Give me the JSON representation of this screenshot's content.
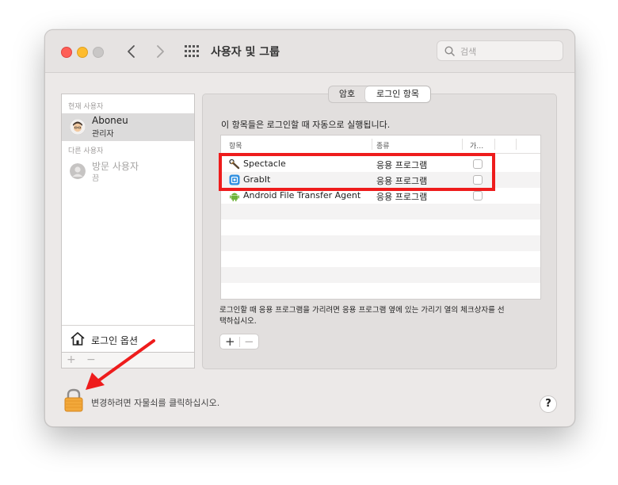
{
  "window": {
    "title": "사용자 및 그룹",
    "search_placeholder": "검색"
  },
  "sidebar": {
    "current_header": "현재 사용자",
    "other_header": "다른 사용자",
    "users": [
      {
        "name": "Aboneu",
        "role": "관리자",
        "selected": true
      },
      {
        "name": "방문 사용자",
        "role": "끔",
        "selected": false
      }
    ],
    "login_options_label": "로그인 옵션",
    "add": "+",
    "remove": "−"
  },
  "tabs": {
    "items": [
      "암호",
      "로그인 항목"
    ],
    "selected": "로그인 항목"
  },
  "login_items": {
    "description": "이 항목들은 로그인할 때 자동으로 실행됩니다.",
    "columns": [
      "항목",
      "종류",
      "가…"
    ],
    "rows": [
      {
        "name": "Spectacle",
        "kind": "응용 프로그램",
        "hide": false,
        "icon": "spectacle-icon"
      },
      {
        "name": "GrabIt",
        "kind": "응용 프로그램",
        "hide": false,
        "icon": "grabit-icon"
      },
      {
        "name": "Android File Transfer Agent",
        "kind": "응용 프로그램",
        "hide": false,
        "icon": "android-icon"
      }
    ],
    "note": "로그인할 때 응용 프로그램을 가리려면 응용 프로그램 옆에 있는 가리기 열의 체크상자를 선택하십시오.",
    "add": "+",
    "remove": "−"
  },
  "footer": {
    "lock_text": "변경하려면 자물쇠를 클릭하십시오.",
    "help": "?"
  },
  "colors": {
    "annotation": "#ee1c1c",
    "lock": "#f0a53a"
  }
}
